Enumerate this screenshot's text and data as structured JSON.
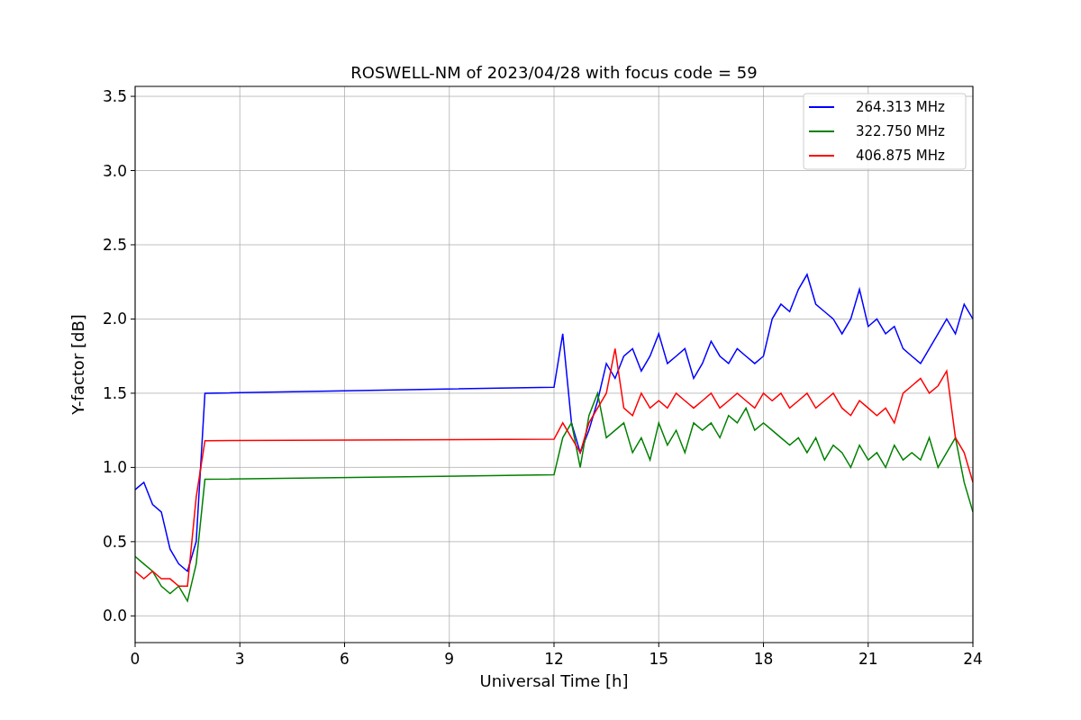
{
  "chart_data": {
    "type": "line",
    "title": "ROSWELL-NM of 2023/04/28 with focus code = 59",
    "xlabel": "Universal Time [h]",
    "ylabel": "Y-factor [dB]",
    "x": [
      0,
      0.25,
      0.5,
      0.75,
      1,
      1.25,
      1.5,
      1.75,
      2,
      12,
      12.25,
      12.5,
      12.75,
      13,
      13.25,
      13.5,
      13.75,
      14,
      14.25,
      14.5,
      14.75,
      15,
      15.25,
      15.5,
      15.75,
      16,
      16.25,
      16.5,
      16.75,
      17,
      17.25,
      17.5,
      17.75,
      18,
      18.25,
      18.5,
      18.75,
      19,
      19.25,
      19.5,
      19.75,
      20,
      20.25,
      20.5,
      20.75,
      21,
      21.25,
      21.5,
      21.75,
      22,
      22.25,
      22.5,
      22.75,
      23,
      23.25,
      23.5,
      23.75,
      24
    ],
    "series": [
      {
        "name": "264.313 MHz",
        "color": "#0000ff",
        "values": [
          0.85,
          0.9,
          0.75,
          0.7,
          0.45,
          0.35,
          0.3,
          0.5,
          1.5,
          1.54,
          1.9,
          1.3,
          1.1,
          1.25,
          1.45,
          1.7,
          1.6,
          1.75,
          1.8,
          1.65,
          1.75,
          1.9,
          1.7,
          1.75,
          1.8,
          1.6,
          1.7,
          1.85,
          1.75,
          1.7,
          1.8,
          1.75,
          1.7,
          1.75,
          2.0,
          2.1,
          2.05,
          2.2,
          2.3,
          2.1,
          2.05,
          2.0,
          1.9,
          2.0,
          2.2,
          1.95,
          2.0,
          1.9,
          1.95,
          1.8,
          1.75,
          1.7,
          1.8,
          1.9,
          2.0,
          1.9,
          2.1,
          2.0
        ]
      },
      {
        "name": "322.750 MHz",
        "color": "#008000",
        "values": [
          0.4,
          0.35,
          0.3,
          0.2,
          0.15,
          0.2,
          0.1,
          0.35,
          0.92,
          0.95,
          1.2,
          1.3,
          1.0,
          1.35,
          1.5,
          1.2,
          1.25,
          1.3,
          1.1,
          1.2,
          1.05,
          1.3,
          1.15,
          1.25,
          1.1,
          1.3,
          1.25,
          1.3,
          1.2,
          1.35,
          1.3,
          1.4,
          1.25,
          1.3,
          1.25,
          1.2,
          1.15,
          1.2,
          1.1,
          1.2,
          1.05,
          1.15,
          1.1,
          1.0,
          1.15,
          1.05,
          1.1,
          1.0,
          1.15,
          1.05,
          1.1,
          1.05,
          1.2,
          1.0,
          1.1,
          1.2,
          0.9,
          0.7
        ]
      },
      {
        "name": "406.875 MHz",
        "color": "#ff0000",
        "values": [
          0.3,
          0.25,
          0.3,
          0.25,
          0.25,
          0.2,
          0.2,
          0.8,
          1.18,
          1.19,
          1.3,
          1.2,
          1.1,
          1.3,
          1.4,
          1.5,
          1.8,
          1.4,
          1.35,
          1.5,
          1.4,
          1.45,
          1.4,
          1.5,
          1.45,
          1.4,
          1.45,
          1.5,
          1.4,
          1.45,
          1.5,
          1.45,
          1.4,
          1.5,
          1.45,
          1.5,
          1.4,
          1.45,
          1.5,
          1.4,
          1.45,
          1.5,
          1.4,
          1.35,
          1.45,
          1.4,
          1.35,
          1.4,
          1.3,
          1.5,
          1.55,
          1.6,
          1.5,
          1.55,
          1.65,
          1.2,
          1.1,
          0.9
        ]
      }
    ],
    "grid": true,
    "legend": true,
    "xlim": [
      0,
      24
    ],
    "ylim": [
      -0.18,
      3.567
    ],
    "xticks": [
      0,
      3,
      6,
      9,
      12,
      15,
      18,
      21,
      24
    ],
    "yticks": [
      {
        "value": 0,
        "label": "0.0"
      },
      {
        "value": 0.5,
        "label": "0.5"
      },
      {
        "value": 1,
        "label": "1.0"
      },
      {
        "value": 1.5,
        "label": "1.5"
      },
      {
        "value": 2,
        "label": "2.0"
      },
      {
        "value": 2.5,
        "label": "2.5"
      },
      {
        "value": 3,
        "label": "3.0"
      },
      {
        "value": 3.5,
        "label": "3.5"
      }
    ]
  }
}
